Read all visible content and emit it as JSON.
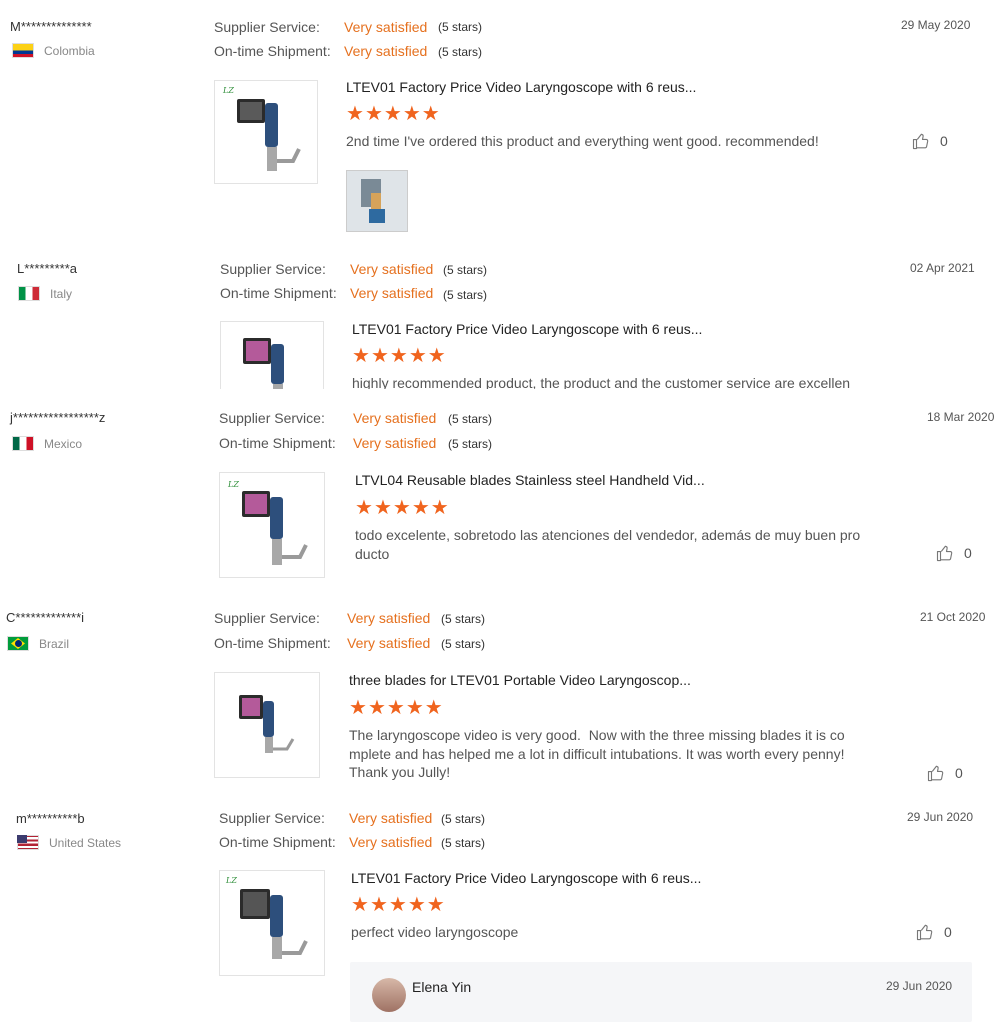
{
  "reviews": [
    {
      "name": "M**************",
      "country": "Colombia",
      "supplier_service_label": "Supplier Service:",
      "supplier_service_value": "Very satisfied",
      "supplier_service_stars": "(5 stars)",
      "shipment_label": "On-time Shipment:",
      "shipment_value": "Very satisfied",
      "shipment_stars": "(5 stars)",
      "date": "29 May 2020",
      "product_title": "LTEV01 Factory Price Video Laryngoscope with 6 reus...",
      "rating": 5,
      "comment": "2nd time I've ordered this product and everything went good. recommended!",
      "helpful_count": "0"
    },
    {
      "name": "L*********a",
      "country": "Italy",
      "supplier_service_label": "Supplier Service:",
      "supplier_service_value": "Very satisfied",
      "supplier_service_stars": "(5 stars)",
      "shipment_label": "On-time Shipment:",
      "shipment_value": "Very satisfied",
      "shipment_stars": "(5 stars)",
      "date": "02 Apr 2021",
      "product_title": "LTEV01 Factory Price Video Laryngoscope with 6 reus...",
      "rating": 5,
      "comment": "highly recommended product, the product and the customer service are excellen"
    },
    {
      "name": "j*****************z",
      "country": "Mexico",
      "supplier_service_label": "Supplier Service:",
      "supplier_service_value": "Very satisfied",
      "supplier_service_stars": "(5 stars)",
      "shipment_label": "On-time Shipment:",
      "shipment_value": "Very satisfied",
      "shipment_stars": "(5 stars)",
      "date": "18 Mar 2020",
      "product_title": "LTVL04 Reusable blades Stainless steel Handheld Vid...",
      "rating": 5,
      "comment": "todo excelente, sobretodo las atenciones del vendedor, además de muy buen pro\nducto",
      "helpful_count": "0"
    },
    {
      "name": "C*************i",
      "country": "Brazil",
      "supplier_service_label": "Supplier Service:",
      "supplier_service_value": "Very satisfied",
      "supplier_service_stars": "(5 stars)",
      "shipment_label": "On-time Shipment:",
      "shipment_value": "Very satisfied",
      "shipment_stars": "(5 stars)",
      "date": "21 Oct 2020",
      "product_title": "three blades for LTEV01 Portable Video Laryngoscop...",
      "rating": 5,
      "comment": "The laryngoscope video is very good.  Now with the three missing blades it is co\nmplete and has helped me a lot in difficult intubations. It was worth every penny!\nThank you Jully!",
      "helpful_count": "0"
    },
    {
      "name": "m**********b",
      "country": "United States",
      "supplier_service_label": "Supplier Service:",
      "supplier_service_value": "Very satisfied",
      "supplier_service_stars": "(5 stars)",
      "shipment_label": "On-time Shipment:",
      "shipment_value": "Very satisfied",
      "shipment_stars": "(5 stars)",
      "date": "29 Jun 2020",
      "product_title": "LTEV01 Factory Price Video Laryngoscope with 6 reus...",
      "rating": 5,
      "comment": "perfect video laryngoscope",
      "helpful_count": "0"
    }
  ],
  "supplier_reply": {
    "name": "Elena Yin",
    "date": "29 Jun 2020"
  },
  "icons": {
    "star": "★",
    "thumb": "thumbs-up-icon"
  },
  "colors": {
    "accent": "#e5701e",
    "star": "#f0641e"
  }
}
